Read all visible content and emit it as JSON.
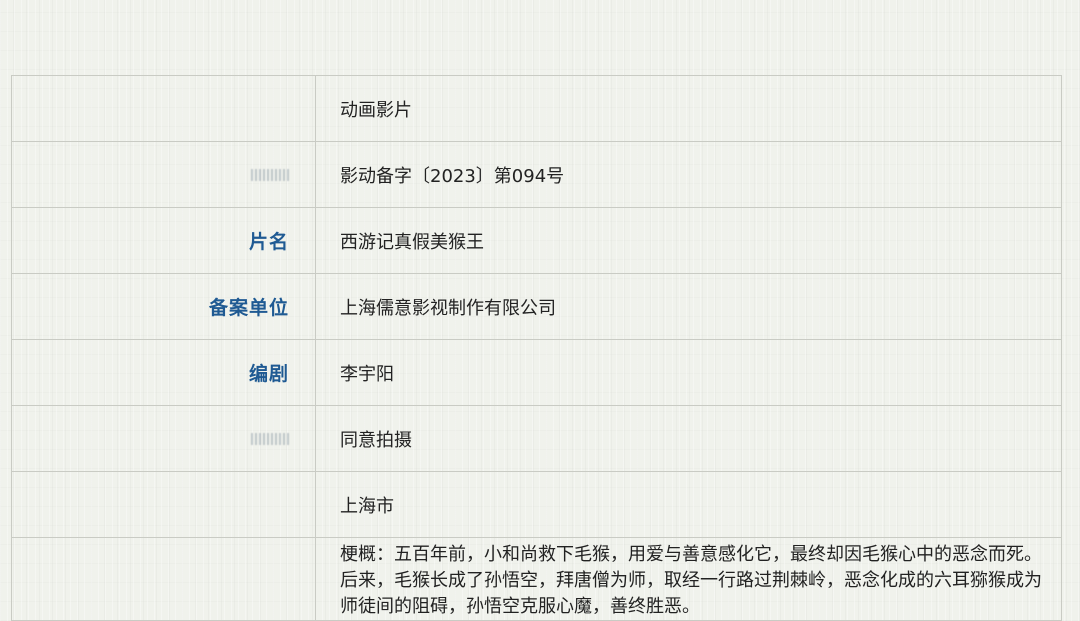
{
  "record": {
    "rows": [
      {
        "label": "",
        "value": "动画影片"
      },
      {
        "label": "",
        "value": "影动备字〔2023〕第094号"
      },
      {
        "label": "片名",
        "value": "西游记真假美猴王"
      },
      {
        "label": "备案单位",
        "value": "上海儒意影视制作有限公司"
      },
      {
        "label": "编剧",
        "value": "李宇阳"
      },
      {
        "label": "",
        "value": "同意拍摄"
      },
      {
        "label": "",
        "value": "上海市"
      }
    ],
    "synopsis": "梗概：五百年前，小和尚救下毛猴，用爱与善意感化它，最终却因毛猴心中的恶念而死。后来，毛猴长成了孙悟空，拜唐僧为师，取经一行路过荆棘岭，恶念化成的六耳猕猴成为师徒间的阻碍，孙悟空克服心魔，善终胜恶。"
  },
  "colors": {
    "label_text": "#1f5a93",
    "border": "#c9cbc4",
    "background": "#f0f2ec"
  }
}
